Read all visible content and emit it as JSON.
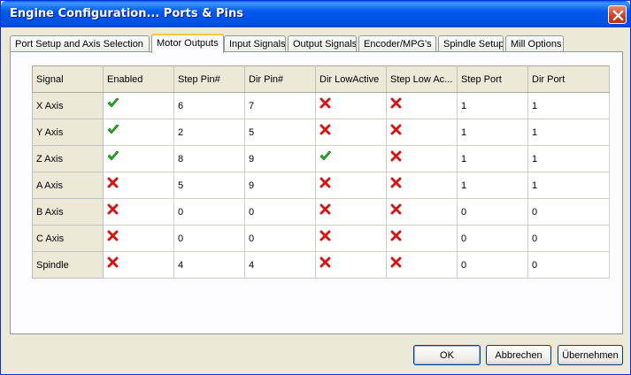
{
  "window": {
    "title": "Engine Configuration... Ports & Pins"
  },
  "tabs": [
    {
      "label": "Port Setup and Axis Selection"
    },
    {
      "label": "Motor Outputs"
    },
    {
      "label": "Input Signals"
    },
    {
      "label": "Output Signals"
    },
    {
      "label": "Encoder/MPG's"
    },
    {
      "label": "Spindle Setup"
    },
    {
      "label": "Mill Options"
    }
  ],
  "active_tab": "Motor Outputs",
  "grid": {
    "columns": [
      "Signal",
      "Enabled",
      "Step Pin#",
      "Dir Pin#",
      "Dir LowActive",
      "Step Low Ac...",
      "Step Port",
      "Dir Port"
    ],
    "rows": [
      {
        "signal": "X Axis",
        "enabled": "check",
        "step_pin": "6",
        "dir_pin": "7",
        "dir_low_active": "cross",
        "step_low_active": "cross",
        "step_port": "1",
        "dir_port": "1"
      },
      {
        "signal": "Y Axis",
        "enabled": "check",
        "step_pin": "2",
        "dir_pin": "5",
        "dir_low_active": "cross",
        "step_low_active": "cross",
        "step_port": "1",
        "dir_port": "1"
      },
      {
        "signal": "Z Axis",
        "enabled": "check",
        "step_pin": "8",
        "dir_pin": "9",
        "dir_low_active": "check",
        "step_low_active": "cross",
        "step_port": "1",
        "dir_port": "1"
      },
      {
        "signal": "A Axis",
        "enabled": "cross",
        "step_pin": "5",
        "dir_pin": "9",
        "dir_low_active": "cross",
        "step_low_active": "cross",
        "step_port": "1",
        "dir_port": "1"
      },
      {
        "signal": "B Axis",
        "enabled": "cross",
        "step_pin": "0",
        "dir_pin": "0",
        "dir_low_active": "cross",
        "step_low_active": "cross",
        "step_port": "0",
        "dir_port": "0"
      },
      {
        "signal": "C Axis",
        "enabled": "cross",
        "step_pin": "0",
        "dir_pin": "0",
        "dir_low_active": "cross",
        "step_low_active": "cross",
        "step_port": "0",
        "dir_port": "0"
      },
      {
        "signal": "Spindle",
        "enabled": "cross",
        "step_pin": "4",
        "dir_pin": "4",
        "dir_low_active": "cross",
        "step_low_active": "cross",
        "step_port": "0",
        "dir_port": "0"
      }
    ]
  },
  "buttons": {
    "ok": "OK",
    "cancel": "Abbrechen",
    "apply": "Übernehmen"
  },
  "colors": {
    "check": "#22b422",
    "cross": "#d01818",
    "title_bar": "#0058ee"
  }
}
